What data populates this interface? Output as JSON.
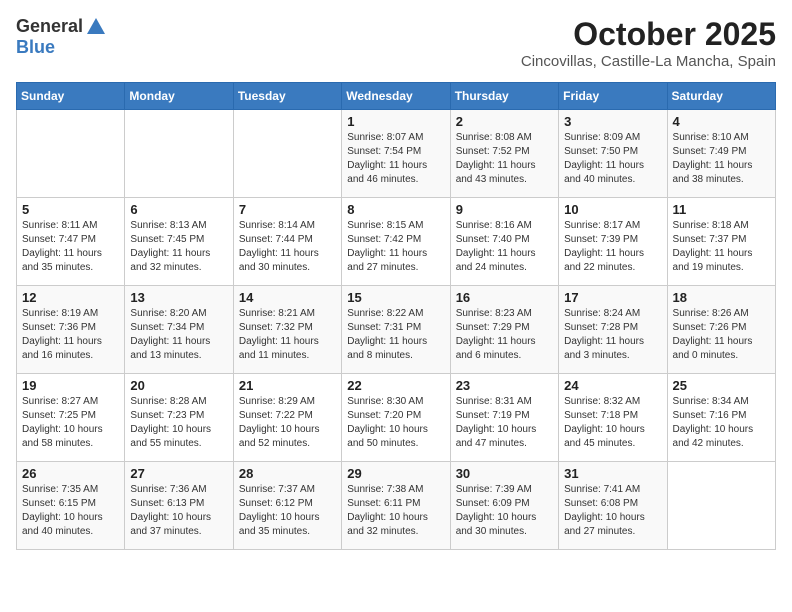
{
  "header": {
    "logo_general": "General",
    "logo_blue": "Blue",
    "month_title": "October 2025",
    "location": "Cincovillas, Castille-La Mancha, Spain"
  },
  "weekdays": [
    "Sunday",
    "Monday",
    "Tuesday",
    "Wednesday",
    "Thursday",
    "Friday",
    "Saturday"
  ],
  "weeks": [
    [
      {
        "day": "",
        "text": ""
      },
      {
        "day": "",
        "text": ""
      },
      {
        "day": "",
        "text": ""
      },
      {
        "day": "1",
        "text": "Sunrise: 8:07 AM\nSunset: 7:54 PM\nDaylight: 11 hours\nand 46 minutes."
      },
      {
        "day": "2",
        "text": "Sunrise: 8:08 AM\nSunset: 7:52 PM\nDaylight: 11 hours\nand 43 minutes."
      },
      {
        "day": "3",
        "text": "Sunrise: 8:09 AM\nSunset: 7:50 PM\nDaylight: 11 hours\nand 40 minutes."
      },
      {
        "day": "4",
        "text": "Sunrise: 8:10 AM\nSunset: 7:49 PM\nDaylight: 11 hours\nand 38 minutes."
      }
    ],
    [
      {
        "day": "5",
        "text": "Sunrise: 8:11 AM\nSunset: 7:47 PM\nDaylight: 11 hours\nand 35 minutes."
      },
      {
        "day": "6",
        "text": "Sunrise: 8:13 AM\nSunset: 7:45 PM\nDaylight: 11 hours\nand 32 minutes."
      },
      {
        "day": "7",
        "text": "Sunrise: 8:14 AM\nSunset: 7:44 PM\nDaylight: 11 hours\nand 30 minutes."
      },
      {
        "day": "8",
        "text": "Sunrise: 8:15 AM\nSunset: 7:42 PM\nDaylight: 11 hours\nand 27 minutes."
      },
      {
        "day": "9",
        "text": "Sunrise: 8:16 AM\nSunset: 7:40 PM\nDaylight: 11 hours\nand 24 minutes."
      },
      {
        "day": "10",
        "text": "Sunrise: 8:17 AM\nSunset: 7:39 PM\nDaylight: 11 hours\nand 22 minutes."
      },
      {
        "day": "11",
        "text": "Sunrise: 8:18 AM\nSunset: 7:37 PM\nDaylight: 11 hours\nand 19 minutes."
      }
    ],
    [
      {
        "day": "12",
        "text": "Sunrise: 8:19 AM\nSunset: 7:36 PM\nDaylight: 11 hours\nand 16 minutes."
      },
      {
        "day": "13",
        "text": "Sunrise: 8:20 AM\nSunset: 7:34 PM\nDaylight: 11 hours\nand 13 minutes."
      },
      {
        "day": "14",
        "text": "Sunrise: 8:21 AM\nSunset: 7:32 PM\nDaylight: 11 hours\nand 11 minutes."
      },
      {
        "day": "15",
        "text": "Sunrise: 8:22 AM\nSunset: 7:31 PM\nDaylight: 11 hours\nand 8 minutes."
      },
      {
        "day": "16",
        "text": "Sunrise: 8:23 AM\nSunset: 7:29 PM\nDaylight: 11 hours\nand 6 minutes."
      },
      {
        "day": "17",
        "text": "Sunrise: 8:24 AM\nSunset: 7:28 PM\nDaylight: 11 hours\nand 3 minutes."
      },
      {
        "day": "18",
        "text": "Sunrise: 8:26 AM\nSunset: 7:26 PM\nDaylight: 11 hours\nand 0 minutes."
      }
    ],
    [
      {
        "day": "19",
        "text": "Sunrise: 8:27 AM\nSunset: 7:25 PM\nDaylight: 10 hours\nand 58 minutes."
      },
      {
        "day": "20",
        "text": "Sunrise: 8:28 AM\nSunset: 7:23 PM\nDaylight: 10 hours\nand 55 minutes."
      },
      {
        "day": "21",
        "text": "Sunrise: 8:29 AM\nSunset: 7:22 PM\nDaylight: 10 hours\nand 52 minutes."
      },
      {
        "day": "22",
        "text": "Sunrise: 8:30 AM\nSunset: 7:20 PM\nDaylight: 10 hours\nand 50 minutes."
      },
      {
        "day": "23",
        "text": "Sunrise: 8:31 AM\nSunset: 7:19 PM\nDaylight: 10 hours\nand 47 minutes."
      },
      {
        "day": "24",
        "text": "Sunrise: 8:32 AM\nSunset: 7:18 PM\nDaylight: 10 hours\nand 45 minutes."
      },
      {
        "day": "25",
        "text": "Sunrise: 8:34 AM\nSunset: 7:16 PM\nDaylight: 10 hours\nand 42 minutes."
      }
    ],
    [
      {
        "day": "26",
        "text": "Sunrise: 7:35 AM\nSunset: 6:15 PM\nDaylight: 10 hours\nand 40 minutes."
      },
      {
        "day": "27",
        "text": "Sunrise: 7:36 AM\nSunset: 6:13 PM\nDaylight: 10 hours\nand 37 minutes."
      },
      {
        "day": "28",
        "text": "Sunrise: 7:37 AM\nSunset: 6:12 PM\nDaylight: 10 hours\nand 35 minutes."
      },
      {
        "day": "29",
        "text": "Sunrise: 7:38 AM\nSunset: 6:11 PM\nDaylight: 10 hours\nand 32 minutes."
      },
      {
        "day": "30",
        "text": "Sunrise: 7:39 AM\nSunset: 6:09 PM\nDaylight: 10 hours\nand 30 minutes."
      },
      {
        "day": "31",
        "text": "Sunrise: 7:41 AM\nSunset: 6:08 PM\nDaylight: 10 hours\nand 27 minutes."
      },
      {
        "day": "",
        "text": ""
      }
    ]
  ]
}
